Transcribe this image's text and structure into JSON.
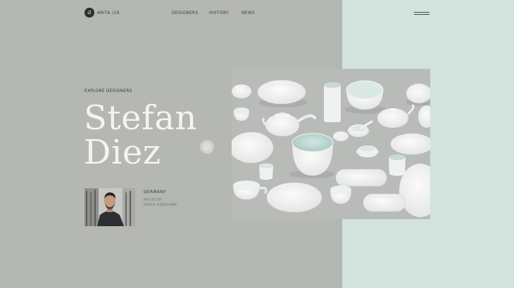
{
  "brand": {
    "mark": "a",
    "name": "ARITA /16"
  },
  "nav": {
    "items": [
      "DESIGNERS",
      "HISTORY",
      "NEWS"
    ]
  },
  "hero": {
    "eyebrow": "EXPLORE DESIGNERS",
    "first_name": "Stefan",
    "last_name": "Diez"
  },
  "designer": {
    "country": "GERMANY",
    "photo_credit_label": "PHOTO BY",
    "photo_credit_name": "KENTA HASEGAWA"
  },
  "colors": {
    "background": "#b5b7b3",
    "accent_panel": "#d2e3dd",
    "headline": "#f3f3f1",
    "text": "#3a3c3e"
  }
}
